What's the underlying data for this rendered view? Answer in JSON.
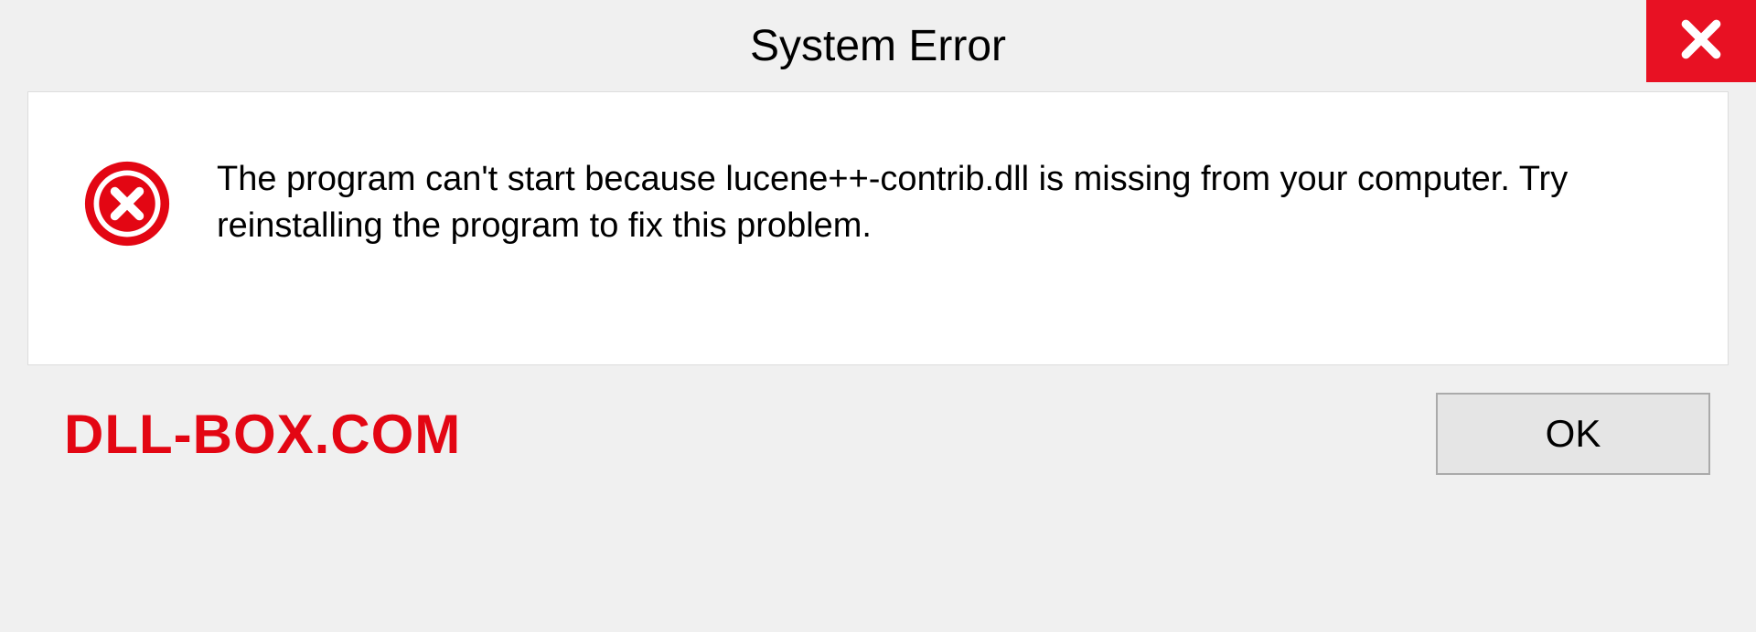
{
  "dialog": {
    "title": "System Error",
    "message": "The program can't start because lucene++-contrib.dll is missing from your computer. Try reinstalling the program to fix this problem.",
    "ok_label": "OK"
  },
  "watermark": "DLL-BOX.COM",
  "colors": {
    "close_bg": "#e81123",
    "error_red": "#e30613"
  }
}
